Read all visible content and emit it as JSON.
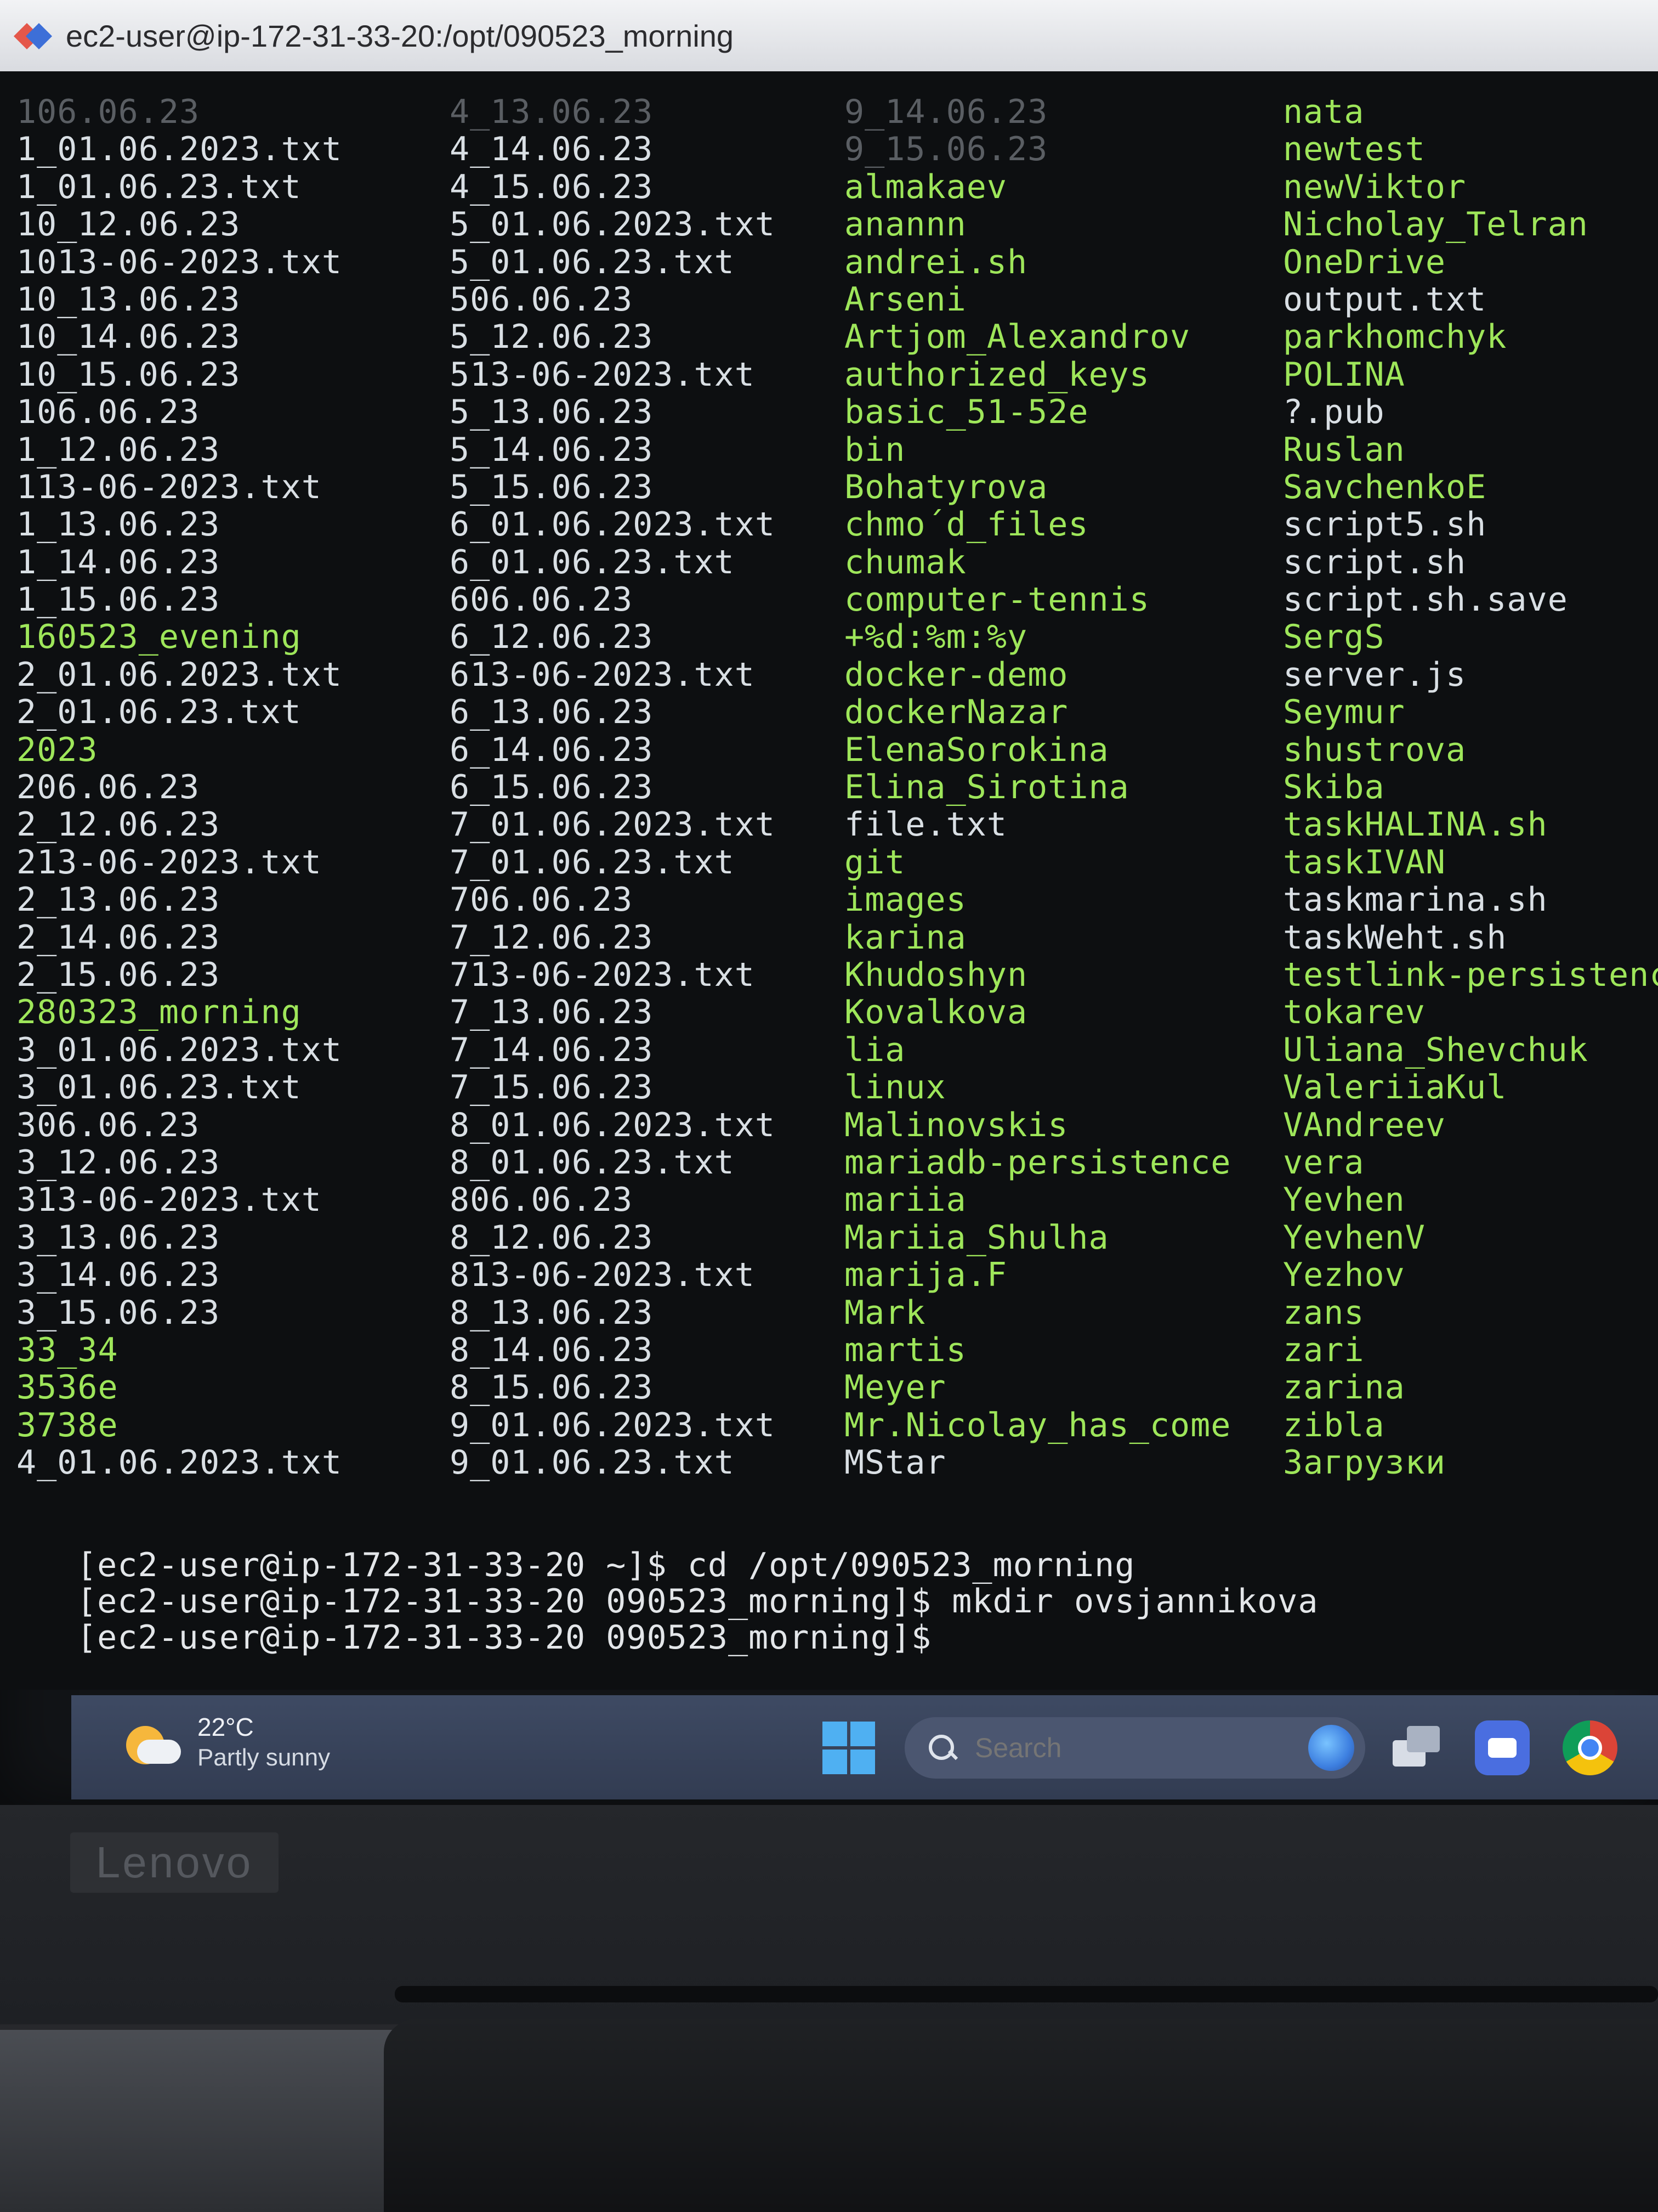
{
  "window": {
    "title": "ec2-user@ip-172-31-33-20:/opt/090523_morning"
  },
  "listing": {
    "col1": [
      {
        "name": "106.06.23",
        "kind": "faded"
      },
      {
        "name": "1_01.06.2023.txt",
        "kind": "file"
      },
      {
        "name": "1_01.06.23.txt",
        "kind": "file"
      },
      {
        "name": "10_12.06.23",
        "kind": "file"
      },
      {
        "name": "1013-06-2023.txt",
        "kind": "file"
      },
      {
        "name": "10_13.06.23",
        "kind": "file"
      },
      {
        "name": "10_14.06.23",
        "kind": "file"
      },
      {
        "name": "10_15.06.23",
        "kind": "file"
      },
      {
        "name": "106.06.23",
        "kind": "file"
      },
      {
        "name": "1_12.06.23",
        "kind": "file"
      },
      {
        "name": "113-06-2023.txt",
        "kind": "file"
      },
      {
        "name": "1_13.06.23",
        "kind": "file"
      },
      {
        "name": "1_14.06.23",
        "kind": "file"
      },
      {
        "name": "1_15.06.23",
        "kind": "file"
      },
      {
        "name": "160523_evening",
        "kind": "dir"
      },
      {
        "name": "2_01.06.2023.txt",
        "kind": "file"
      },
      {
        "name": "2_01.06.23.txt",
        "kind": "file"
      },
      {
        "name": "2023",
        "kind": "dir"
      },
      {
        "name": "206.06.23",
        "kind": "file"
      },
      {
        "name": "2_12.06.23",
        "kind": "file"
      },
      {
        "name": "213-06-2023.txt",
        "kind": "file"
      },
      {
        "name": "2_13.06.23",
        "kind": "file"
      },
      {
        "name": "2_14.06.23",
        "kind": "file"
      },
      {
        "name": "2_15.06.23",
        "kind": "file"
      },
      {
        "name": "280323_morning",
        "kind": "dir"
      },
      {
        "name": "3_01.06.2023.txt",
        "kind": "file"
      },
      {
        "name": "3_01.06.23.txt",
        "kind": "file"
      },
      {
        "name": "306.06.23",
        "kind": "file"
      },
      {
        "name": "3_12.06.23",
        "kind": "file"
      },
      {
        "name": "313-06-2023.txt",
        "kind": "file"
      },
      {
        "name": "3_13.06.23",
        "kind": "file"
      },
      {
        "name": "3_14.06.23",
        "kind": "file"
      },
      {
        "name": "3_15.06.23",
        "kind": "file"
      },
      {
        "name": "33_34",
        "kind": "dir"
      },
      {
        "name": "3536e",
        "kind": "dir"
      },
      {
        "name": "3738e",
        "kind": "dir"
      },
      {
        "name": "4_01.06.2023.txt",
        "kind": "file"
      }
    ],
    "col2": [
      {
        "name": "4_13.06.23",
        "kind": "faded"
      },
      {
        "name": "4_14.06.23",
        "kind": "file"
      },
      {
        "name": "4_15.06.23",
        "kind": "file"
      },
      {
        "name": "5_01.06.2023.txt",
        "kind": "file"
      },
      {
        "name": "5_01.06.23.txt",
        "kind": "file"
      },
      {
        "name": "506.06.23",
        "kind": "file"
      },
      {
        "name": "5_12.06.23",
        "kind": "file"
      },
      {
        "name": "513-06-2023.txt",
        "kind": "file"
      },
      {
        "name": "5_13.06.23",
        "kind": "file"
      },
      {
        "name": "5_14.06.23",
        "kind": "file"
      },
      {
        "name": "5_15.06.23",
        "kind": "file"
      },
      {
        "name": "6_01.06.2023.txt",
        "kind": "file"
      },
      {
        "name": "6_01.06.23.txt",
        "kind": "file"
      },
      {
        "name": "606.06.23",
        "kind": "file"
      },
      {
        "name": "6_12.06.23",
        "kind": "file"
      },
      {
        "name": "613-06-2023.txt",
        "kind": "file"
      },
      {
        "name": "6_13.06.23",
        "kind": "file"
      },
      {
        "name": "6_14.06.23",
        "kind": "file"
      },
      {
        "name": "6_15.06.23",
        "kind": "file"
      },
      {
        "name": "7_01.06.2023.txt",
        "kind": "file"
      },
      {
        "name": "7_01.06.23.txt",
        "kind": "file"
      },
      {
        "name": "706.06.23",
        "kind": "file"
      },
      {
        "name": "7_12.06.23",
        "kind": "file"
      },
      {
        "name": "713-06-2023.txt",
        "kind": "file"
      },
      {
        "name": "7_13.06.23",
        "kind": "file"
      },
      {
        "name": "7_14.06.23",
        "kind": "file"
      },
      {
        "name": "7_15.06.23",
        "kind": "file"
      },
      {
        "name": "8_01.06.2023.txt",
        "kind": "file"
      },
      {
        "name": "8_01.06.23.txt",
        "kind": "file"
      },
      {
        "name": "806.06.23",
        "kind": "file"
      },
      {
        "name": "8_12.06.23",
        "kind": "file"
      },
      {
        "name": "813-06-2023.txt",
        "kind": "file"
      },
      {
        "name": "8_13.06.23",
        "kind": "file"
      },
      {
        "name": "8_14.06.23",
        "kind": "file"
      },
      {
        "name": "8_15.06.23",
        "kind": "file"
      },
      {
        "name": "9_01.06.2023.txt",
        "kind": "file"
      },
      {
        "name": "9_01.06.23.txt",
        "kind": "file"
      }
    ],
    "col3": [
      {
        "name": "9_14.06.23",
        "kind": "faded"
      },
      {
        "name": "9_15.06.23",
        "kind": "faded"
      },
      {
        "name": "almakaev",
        "kind": "dir"
      },
      {
        "name": "anannn",
        "kind": "dir"
      },
      {
        "name": "andrei.sh",
        "kind": "dir"
      },
      {
        "name": "Arseni",
        "kind": "dir"
      },
      {
        "name": "Artjom_Alexandrov",
        "kind": "dir"
      },
      {
        "name": "authorized_keys",
        "kind": "dir"
      },
      {
        "name": "basic_51-52e",
        "kind": "dir"
      },
      {
        "name": "bin",
        "kind": "dir"
      },
      {
        "name": "Bohatyrova",
        "kind": "dir"
      },
      {
        "name": "chmo´d_files",
        "kind": "dir"
      },
      {
        "name": "chumak",
        "kind": "dir"
      },
      {
        "name": "computer-tennis",
        "kind": "dir"
      },
      {
        "name": "+%d:%m:%y",
        "kind": "dir"
      },
      {
        "name": "docker-demo",
        "kind": "dir"
      },
      {
        "name": "dockerNazar",
        "kind": "dir"
      },
      {
        "name": "ElenaSorokina",
        "kind": "dir"
      },
      {
        "name": "Elina_Sirotina",
        "kind": "dir"
      },
      {
        "name": "file.txt",
        "kind": "file"
      },
      {
        "name": "git",
        "kind": "dir"
      },
      {
        "name": "images",
        "kind": "dir"
      },
      {
        "name": "karina",
        "kind": "dir"
      },
      {
        "name": "Khudoshyn",
        "kind": "dir"
      },
      {
        "name": "Kovalkova",
        "kind": "dir"
      },
      {
        "name": "lia",
        "kind": "dir"
      },
      {
        "name": "linux",
        "kind": "dir"
      },
      {
        "name": "Malinovskis",
        "kind": "dir"
      },
      {
        "name": "mariadb-persistence",
        "kind": "dir"
      },
      {
        "name": "mariia",
        "kind": "dir"
      },
      {
        "name": "Mariia_Shulha",
        "kind": "dir"
      },
      {
        "name": "marija.F",
        "kind": "dir"
      },
      {
        "name": "Mark",
        "kind": "dir"
      },
      {
        "name": "martis",
        "kind": "dir"
      },
      {
        "name": "Meyer",
        "kind": "dir"
      },
      {
        "name": "Mr.Nicolay_has_come",
        "kind": "dir"
      },
      {
        "name": "MStar",
        "kind": "file"
      }
    ],
    "col4": [
      {
        "name": "nata",
        "kind": "dir"
      },
      {
        "name": "newtest",
        "kind": "dir"
      },
      {
        "name": "newViktor",
        "kind": "dir"
      },
      {
        "name": "Nicholay_Telran",
        "kind": "dir"
      },
      {
        "name": "OneDrive",
        "kind": "dir"
      },
      {
        "name": "output.txt",
        "kind": "file"
      },
      {
        "name": "parkhomchyk",
        "kind": "dir"
      },
      {
        "name": "POLINA",
        "kind": "dir"
      },
      {
        "name": "?.pub",
        "kind": "file"
      },
      {
        "name": "Ruslan",
        "kind": "dir"
      },
      {
        "name": "SavchenkoE",
        "kind": "dir"
      },
      {
        "name": "script5.sh",
        "kind": "file"
      },
      {
        "name": "script.sh",
        "kind": "file"
      },
      {
        "name": "script.sh.save",
        "kind": "file"
      },
      {
        "name": "SergS",
        "kind": "dir"
      },
      {
        "name": "server.js",
        "kind": "file"
      },
      {
        "name": "Seymur",
        "kind": "dir"
      },
      {
        "name": "shustrova",
        "kind": "dir"
      },
      {
        "name": "Skiba",
        "kind": "dir"
      },
      {
        "name": "taskHALINA.sh",
        "kind": "dir"
      },
      {
        "name": "taskIVAN",
        "kind": "dir"
      },
      {
        "name": "taskmarina.sh",
        "kind": "file"
      },
      {
        "name": "taskWeht.sh",
        "kind": "file"
      },
      {
        "name": "testlink-persistence",
        "kind": "dir"
      },
      {
        "name": "tokarev",
        "kind": "dir"
      },
      {
        "name": "Uliana_Shevchuk",
        "kind": "dir"
      },
      {
        "name": "ValeriiaKul",
        "kind": "dir"
      },
      {
        "name": "VAndreev",
        "kind": "dir"
      },
      {
        "name": "vera",
        "kind": "dir"
      },
      {
        "name": "Yevhen",
        "kind": "dir"
      },
      {
        "name": "YevhenV",
        "kind": "dir"
      },
      {
        "name": "Yezhov",
        "kind": "dir"
      },
      {
        "name": "zans",
        "kind": "dir"
      },
      {
        "name": "zari",
        "kind": "dir"
      },
      {
        "name": "zarina",
        "kind": "dir"
      },
      {
        "name": "zibla",
        "kind": "dir"
      },
      {
        "name": "Загрузки",
        "kind": "dir"
      }
    ]
  },
  "prompts": [
    "[ec2-user@ip-172-31-33-20 ~]$ cd /opt/090523_morning",
    "[ec2-user@ip-172-31-33-20 090523_morning]$ mkdir ovsjannikova",
    "[ec2-user@ip-172-31-33-20 090523_morning]$"
  ],
  "taskbar": {
    "weather_temp": "22°C",
    "weather_desc": "Partly sunny",
    "search_placeholder": "Search"
  },
  "laptop": {
    "brand": "Lenovo"
  },
  "colors": {
    "dir": "#9ee65a",
    "file": "#d9dfe4",
    "terminal_bg": "#0d0f11",
    "taskbar_bg": "#3a4560"
  }
}
